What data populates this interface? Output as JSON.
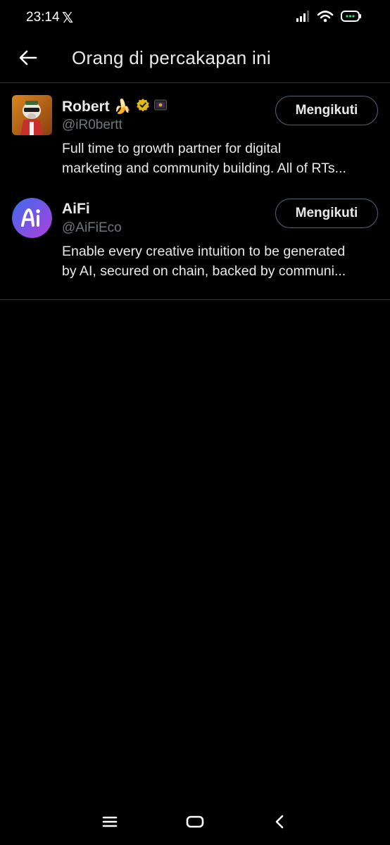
{
  "status_bar": {
    "time": "23:14",
    "app_icon": "x-logo",
    "icons": [
      "signal-icon",
      "wifi-icon",
      "battery-icon"
    ]
  },
  "header": {
    "title": "Orang di percakapan ini",
    "back_icon": "arrow-left-icon"
  },
  "users": [
    {
      "name": "Robert",
      "name_emoji": "🍌",
      "verified": true,
      "affiliate_badge": true,
      "handle": "@iR0bertt",
      "bio_line1": "Full time to growth partner for digital",
      "bio_line2": "marketing and community building. All of RTs...",
      "follow_label": "Mengikuti",
      "avatar_icon": "bear-avatar"
    },
    {
      "name": "AiFi",
      "handle": "@AiFiEco",
      "bio_line1": "Enable every creative intuition to be generated",
      "bio_line2": "by AI, secured on chain, backed by communi...",
      "follow_label": "Mengikuti",
      "avatar_text": "Ai"
    }
  ],
  "nav_bar": {
    "icons": [
      "menu-icon",
      "home-icon",
      "back-icon"
    ]
  },
  "colors": {
    "background": "#000000",
    "text": "#e7e9ea",
    "secondary_text": "#71767b",
    "divider": "#2f3336",
    "verified_gold": "#e2b719",
    "aifi_gradient_start": "#3b6cf0",
    "aifi_gradient_end": "#b03fd8"
  }
}
